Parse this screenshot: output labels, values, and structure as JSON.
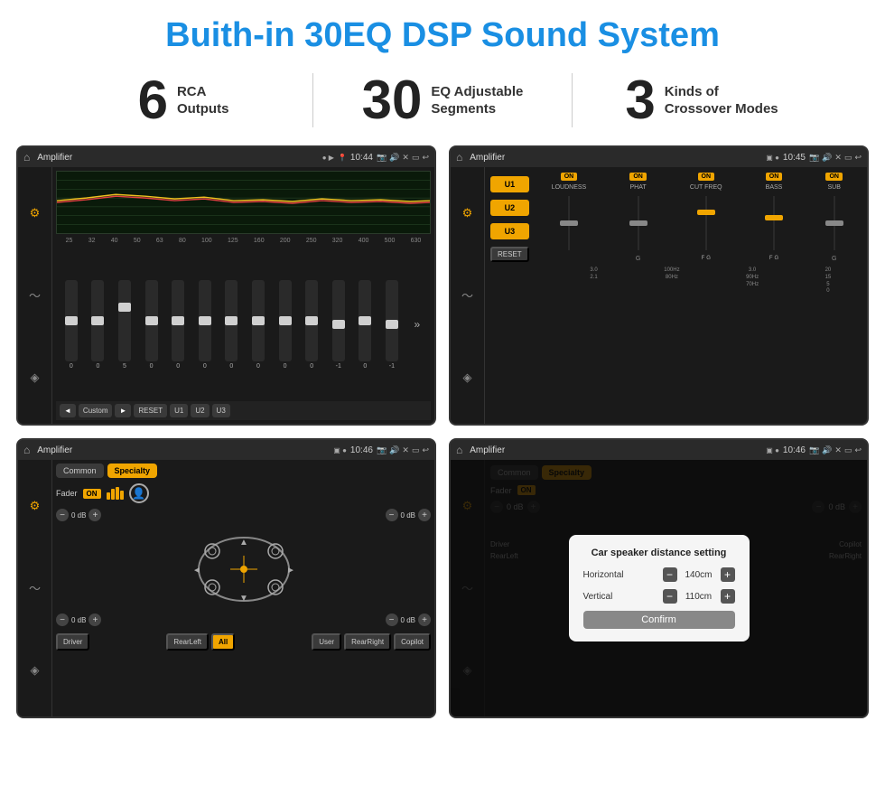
{
  "page": {
    "title": "Buith-in 30EQ DSP Sound System",
    "stats": [
      {
        "number": "6",
        "label": "RCA\nOutputs"
      },
      {
        "number": "30",
        "label": "EQ Adjustable\nSegments"
      },
      {
        "number": "3",
        "label": "Kinds of\nCrossover Modes"
      }
    ],
    "screens": [
      {
        "id": "eq-screen",
        "statusBar": {
          "title": "Amplifier",
          "time": "10:44"
        },
        "type": "eq"
      },
      {
        "id": "amp-screen",
        "statusBar": {
          "title": "Amplifier",
          "time": "10:45"
        },
        "type": "amplifier"
      },
      {
        "id": "cs-screen",
        "statusBar": {
          "title": "Amplifier",
          "time": "10:46"
        },
        "type": "common-specialty"
      },
      {
        "id": "dialog-screen",
        "statusBar": {
          "title": "Amplifier",
          "time": "10:46"
        },
        "type": "dialog"
      }
    ],
    "eq": {
      "frequencies": [
        "25",
        "32",
        "40",
        "50",
        "63",
        "80",
        "100",
        "125",
        "160",
        "200",
        "250",
        "320",
        "400",
        "500",
        "630"
      ],
      "values": [
        "0",
        "0",
        "0",
        "5",
        "0",
        "0",
        "0",
        "0",
        "0",
        "0",
        "0",
        "-1",
        "0",
        "-1"
      ],
      "preset": "Custom",
      "buttons": [
        "◄",
        "Custom",
        "►",
        "RESET",
        "U1",
        "U2",
        "U3"
      ]
    },
    "amplifier": {
      "channels": [
        "U1",
        "U2",
        "U3"
      ],
      "controls": [
        "LOUDNESS",
        "PHAT",
        "CUT FREQ",
        "BASS",
        "SUB"
      ],
      "resetLabel": "RESET"
    },
    "commonSpecialty": {
      "tabs": [
        "Common",
        "Specialty"
      ],
      "activeTab": "Specialty",
      "faderLabel": "Fader",
      "faderOn": "ON",
      "controls": {
        "topLeft": "0 dB",
        "topRight": "0 dB",
        "bottomLeft": "0 dB",
        "bottomRight": "0 dB"
      },
      "bottomLabels": [
        "Driver",
        "",
        "RearLeft",
        "All",
        "",
        "User",
        "RearRight",
        "Copilot"
      ]
    },
    "dialog": {
      "title": "Car speaker distance setting",
      "horizontal": {
        "label": "Horizontal",
        "value": "140cm"
      },
      "vertical": {
        "label": "Vertical",
        "value": "110cm"
      },
      "confirmLabel": "Confirm",
      "rightLabels": {
        "top": "0 dB",
        "bottom": "0 dB"
      }
    }
  }
}
